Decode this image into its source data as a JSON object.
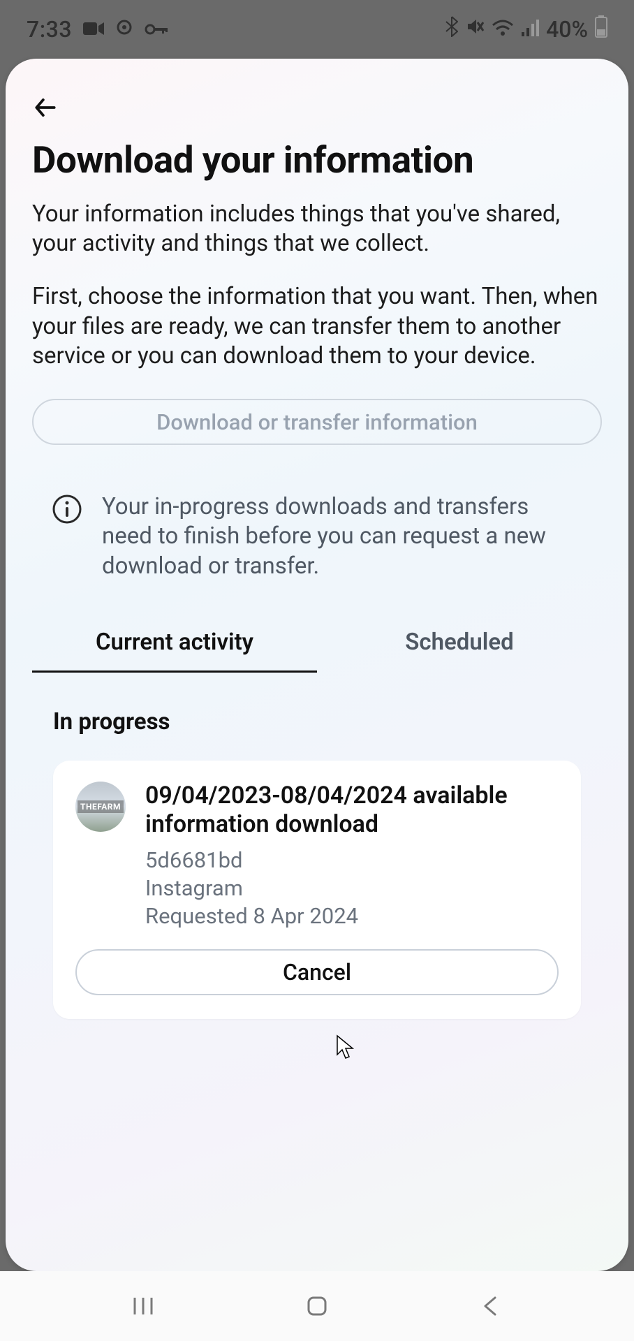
{
  "status": {
    "time": "7:33",
    "battery_text": "40%"
  },
  "header": {
    "title": "Download your information",
    "intro_p1": "Your information includes things that you've shared, your activity and things that we collect.",
    "intro_p2": "First, choose the information that you want. Then, when your files are ready, we can transfer them to another service or you can download them to your device."
  },
  "cta": {
    "download_button": "Download or transfer information"
  },
  "notice": {
    "text": "Your in-progress downloads and transfers need to finish before you can request a new download or transfer."
  },
  "tabs": {
    "current": "Current activity",
    "scheduled": "Scheduled",
    "active_index": 0
  },
  "section": {
    "in_progress_title": "In progress"
  },
  "download_item": {
    "title": "09/04/2023-08/04/2024 available information download",
    "code": "5d6681bd",
    "service": "Instagram",
    "requested": "Requested 8 Apr 2024",
    "cancel_label": "Cancel"
  }
}
